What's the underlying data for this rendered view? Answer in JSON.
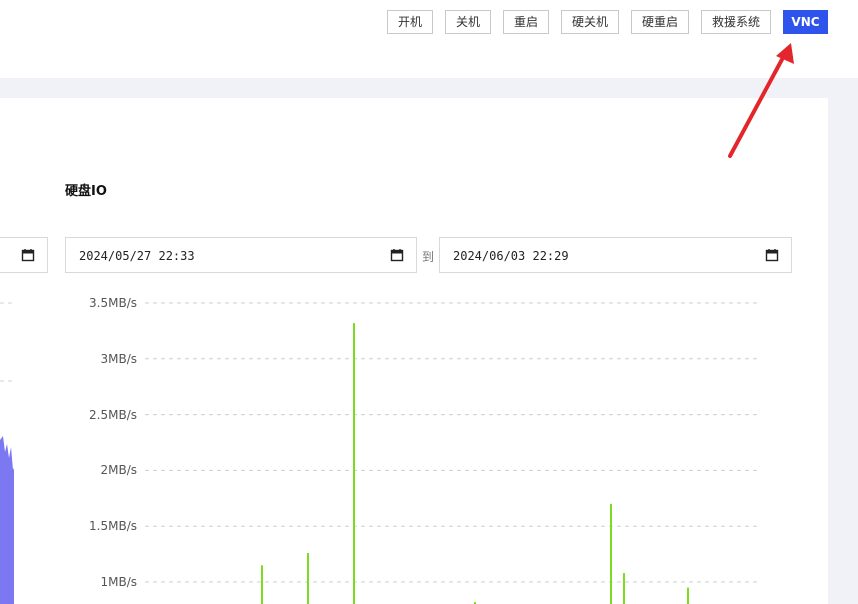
{
  "toolbar": {
    "buttons": [
      "开机",
      "关机",
      "重启",
      "硬关机",
      "硬重启",
      "救援系统",
      "VNC"
    ]
  },
  "disk_io": {
    "title": "硬盘IO",
    "start_value": "2024/05/27 22:33",
    "to_label": "到",
    "end_value": "2024/06/03 22:29"
  },
  "icons": {
    "calendar": "calendar-icon",
    "arrow": "red-arrow-annotation"
  },
  "colors": {
    "primary": "#2f54eb",
    "series": "#7cdc23",
    "annotation": "#e3262b",
    "left_area": "#7b78f2"
  },
  "chart_data": {
    "type": "bar",
    "ylabel": "",
    "y_ticks": [
      "1MB/s",
      "1.5MB/s",
      "2MB/s",
      "2.5MB/s",
      "3MB/s",
      "3.5MB/s"
    ],
    "ylim": [
      1,
      3.5
    ],
    "grid": true,
    "series": [
      {
        "values": [
          1.15,
          1.26,
          3.32,
          0.82,
          1.7,
          1.08,
          0.95
        ]
      }
    ]
  }
}
